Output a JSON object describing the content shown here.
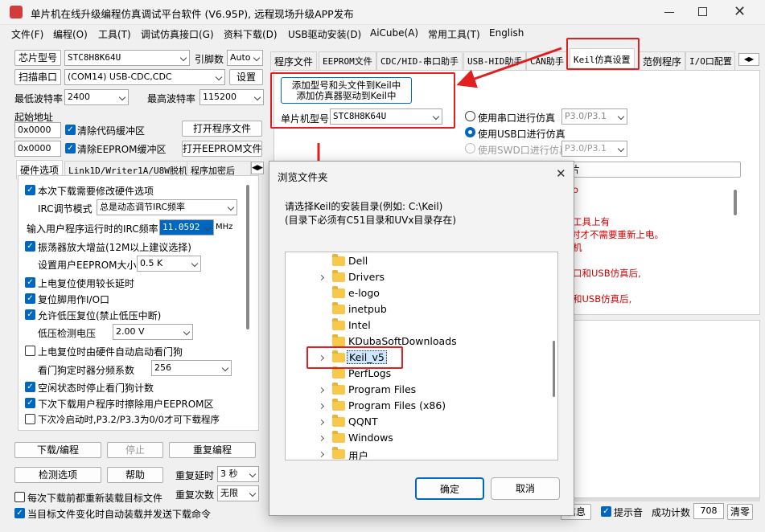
{
  "window": {
    "title": "单片机在线升级编程仿真调试平台软件 (V6.95P), 远程现场升级APP发布"
  },
  "menu": [
    "文件(F)",
    "编程(O)",
    "工具(T)",
    "调试仿真接口(G)",
    "资料下载(D)",
    "USB驱动安装(D)",
    "AiCube(A)",
    "常用工具(T)",
    "English"
  ],
  "left": {
    "chip_label": "芯片型号",
    "chip_value": "STC8H8K64U",
    "pin_label": "引脚数",
    "pin_value": "Auto",
    "scan_label": "扫描串口",
    "port_value": "(COM14) USB-CDC,CDC",
    "settings_label": "设置",
    "min_baud_label": "最低波特率",
    "min_baud_value": "2400",
    "max_baud_label": "最高波特率",
    "max_baud_value": "115200",
    "start_addr_label": "起始地址",
    "addr1": "0x0000",
    "clear_code_label": "清除代码缓冲区",
    "open_prog_label": "打开程序文件",
    "addr2": "0x0000",
    "clear_eeprom_label": "清除EEPROM缓冲区",
    "open_eeprom_label": "打开EEPROM文件"
  },
  "left_tabs": [
    "硬件选项",
    "Link1D/Writer1A/U8W脱机",
    "程序加密后"
  ],
  "hw": {
    "item1": "本次下载需要修改硬件选项",
    "irc_mode_label": "IRC调节模式",
    "irc_mode_value": "总是动态调节IRC频率",
    "irc_freq_label": "输入用户程序运行时的IRC频率",
    "irc_freq_value": "11.0592",
    "mhz": "MHz",
    "item_osc": "振荡器放大增益(12M以上建议选择)",
    "eeprom_size_label": "设置用户EEPROM大小",
    "eeprom_size_value": "0.5 K",
    "item_delay": "上电复位使用较长延时",
    "item_reset": "复位脚用作I/O口",
    "item_lowv": "允许低压复位(禁止低压中断)",
    "lowv_label": "低压检测电压",
    "lowv_value": "2.00 V",
    "item_wdt": "上电复位时由硬件自动启动看门狗",
    "wdt_label": "看门狗定时器分频系数",
    "wdt_value": "256",
    "item_idle": "空闲状态时停止看门狗计数",
    "item_erase": "下次下载用户程序时擦除用户EEPROM区",
    "item_cold": "下次冷启动时,P3.2/P3.3为0/0才可下载程序"
  },
  "bottom": {
    "download": "下载/编程",
    "stop": "停止",
    "reprog": "重复编程",
    "detect": "检测选项",
    "help": "帮助",
    "repeat_delay_label": "重复延时",
    "repeat_delay_value": "3 秒",
    "repeat_count_label": "重复次数",
    "repeat_count_value": "无限",
    "reload_label": "每次下载前都重新装载目标文件",
    "auto_label": "当目标文件变化时自动装载并发送下载命令"
  },
  "right_tabs": [
    "程序文件",
    "EEPROM文件",
    "CDC/HID-串口助手",
    "USB-HID助手",
    "CAN助手",
    "Keil仿真设置",
    "范例程序",
    "I/O口配置"
  ],
  "keil": {
    "add_btn_line1": "添加型号和头文件到Keil中",
    "add_btn_line2": "添加仿真器驱动到Keil中",
    "mcu_label": "单片机型号",
    "mcu_value": "STC8H8K64U",
    "opt_serial": "使用串口进行仿真",
    "opt_serial_pins": "P3.0/P3.1",
    "opt_usb": "使用USB口进行仿真",
    "opt_swd": "使用SWD口进行仿真",
    "opt_swd_pins": "P3.0/P3.1",
    "bar_text": "片",
    "info_lines": [
      "o",
      "工具上有",
      "时才不需要重新上电。",
      "机",
      "口和USB仿真后,",
      "和USB仿真后,"
    ]
  },
  "status": {
    "info_btn": "信息",
    "beep": "提示音",
    "count_label": "成功计数",
    "count_value": "708",
    "clear": "清零"
  },
  "dialog": {
    "title": "浏览文件夹",
    "prompt1": "请选择Keil的安装目录(例如: C:\\Keil)",
    "prompt2": "(目录下必须有C51目录和UVx目录存在)",
    "folders": [
      "Dell",
      "Drivers",
      "e-logo",
      "inetpub",
      "Intel",
      "KDubaSoftDownloads",
      "Keil_v5",
      "PerfLogs",
      "Program Files",
      "Program Files (x86)",
      "QQNT",
      "Windows",
      "用户"
    ],
    "ok": "确定",
    "cancel": "取消"
  },
  "colors": {
    "highlight": "#e02020",
    "accent": "#0067c0",
    "selected_bg": "#cce8ff"
  }
}
